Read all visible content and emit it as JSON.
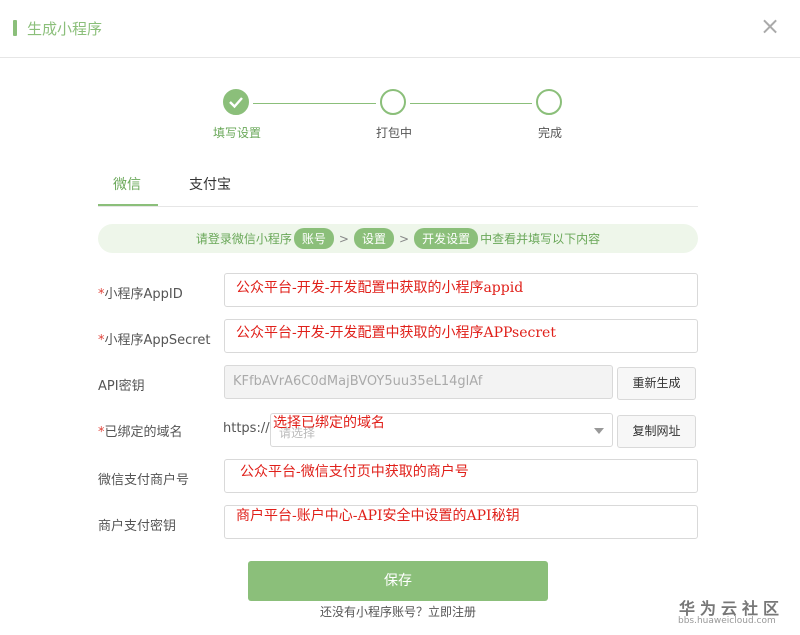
{
  "dialog": {
    "title": "生成小程序",
    "close_glyph": "×"
  },
  "steps": [
    {
      "label": "填写设置",
      "status": "done"
    },
    {
      "label": "打包中",
      "status": "pending"
    },
    {
      "label": "完成",
      "status": "pending"
    }
  ],
  "tabs": [
    {
      "label": "微信",
      "active": true
    },
    {
      "label": "支付宝",
      "active": false
    }
  ],
  "tip": {
    "prefix": "请登录微信小程序",
    "crumbs": [
      "账号",
      "设置",
      "开发设置"
    ],
    "arrow": ">",
    "suffix": "中查看并填写以下内容"
  },
  "form": {
    "required_mark": "*",
    "appid": {
      "label": "小程序AppID",
      "note": "公众平台-开发-开发配置中获取的小程序appid"
    },
    "appsecret": {
      "label": "小程序AppSecret",
      "note": "公众平台-开发-开发配置中获取的小程序APPsecret"
    },
    "api_key": {
      "label": "API密钥",
      "value": "KFfbAVrA6C0dMajBVOY5uu35eL14glAf",
      "button": "重新生成"
    },
    "domain": {
      "label": "已绑定的域名",
      "prefix": "https://",
      "placeholder": "请选择",
      "note": "选择已绑定的域名",
      "button": "复制网址"
    },
    "merchant_no": {
      "label": "微信支付商户号",
      "note": "公众平台-微信支付页中获取的商户号"
    },
    "merchant_key": {
      "label": "商户支付密钥",
      "note": "商户平台-账户中心-API安全中设置的API秘钥"
    }
  },
  "save_label": "保存",
  "footer_link": "还没有小程序账号？立即注册",
  "watermark": {
    "title": "华为云社区",
    "url": "bbs.huaweicloud.com"
  },
  "colors": {
    "accent": "#8bbf7a",
    "required": "#e0433a",
    "annotation": "#e0201a"
  }
}
